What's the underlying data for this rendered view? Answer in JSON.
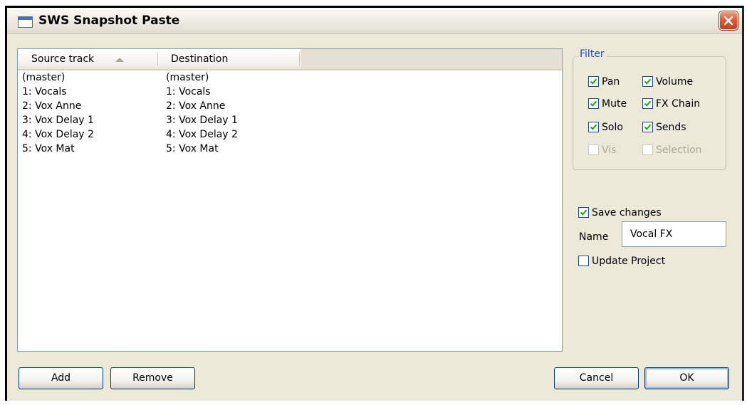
{
  "window": {
    "title": "SWS Snapshot Paste"
  },
  "list": {
    "columns": [
      "Source track",
      "Destination"
    ],
    "rows": [
      {
        "source": "(master)",
        "destination": "(master)"
      },
      {
        "source": "1: Vocals",
        "destination": "1: Vocals"
      },
      {
        "source": "2: Vox Anne",
        "destination": "2: Vox Anne"
      },
      {
        "source": "3: Vox Delay 1",
        "destination": "3: Vox Delay 1"
      },
      {
        "source": "4: Vox Delay 2",
        "destination": "4: Vox Delay 2"
      },
      {
        "source": "5: Vox Mat",
        "destination": "5: Vox Mat"
      }
    ]
  },
  "filter": {
    "title": "Filter",
    "pan": {
      "label": "Pan",
      "checked": true
    },
    "volume": {
      "label": "Volume",
      "checked": true
    },
    "mute": {
      "label": "Mute",
      "checked": true
    },
    "fx_chain": {
      "label": "FX Chain",
      "checked": true
    },
    "solo": {
      "label": "Solo",
      "checked": true
    },
    "sends": {
      "label": "Sends",
      "checked": true
    },
    "vis": {
      "label": "Vis",
      "checked": false,
      "disabled": true
    },
    "selection": {
      "label": "Selection",
      "checked": false,
      "disabled": true
    }
  },
  "save_changes": {
    "label": "Save changes",
    "checked": true
  },
  "name_field": {
    "label": "Name",
    "value": "Vocal FX"
  },
  "update_project": {
    "label": "Update Project",
    "checked": false
  },
  "buttons": {
    "add": "Add",
    "remove": "Remove",
    "cancel": "Cancel",
    "ok": "OK"
  },
  "colors": {
    "dialog_bg": "#ece9d8",
    "group_title": "#1f49c8",
    "check_mark": "#21a121",
    "close_button": "#e05a30"
  }
}
